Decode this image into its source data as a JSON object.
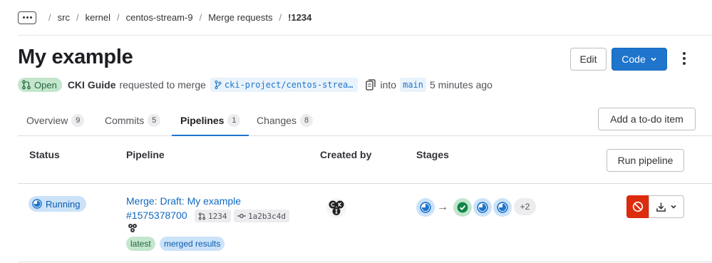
{
  "breadcrumb": {
    "items": [
      "src",
      "kernel",
      "centos-stream-9",
      "Merge requests",
      "!1234"
    ]
  },
  "mr": {
    "title": "My example",
    "edit_label": "Edit",
    "code_label": "Code",
    "status": "Open",
    "author": "CKI Guide",
    "requested_text": "requested to merge",
    "source_branch": "cki-project/centos-strea…",
    "into_text": "into",
    "target_branch": "main",
    "time_ago": "5 minutes ago"
  },
  "tabs": [
    {
      "label": "Overview",
      "count": "9"
    },
    {
      "label": "Commits",
      "count": "5"
    },
    {
      "label": "Pipelines",
      "count": "1"
    },
    {
      "label": "Changes",
      "count": "8"
    }
  ],
  "todo_label": "Add a to-do item",
  "table": {
    "headers": {
      "status": "Status",
      "pipeline": "Pipeline",
      "created_by": "Created by",
      "stages": "Stages"
    },
    "run_pipeline_label": "Run pipeline"
  },
  "pipeline": {
    "status": "Running",
    "title": "Merge: Draft: My example",
    "id": "#1575378700",
    "mr_ref": "1234",
    "commit": "1a2b3c4d",
    "labels": [
      "latest",
      "merged results"
    ],
    "stages": [
      "running",
      "success",
      "running",
      "running"
    ],
    "more_stages": "+2"
  },
  "colors": {
    "link": "#1068bf",
    "primary": "#1f75cb",
    "danger": "#dd2b0e",
    "running_bg": "#cbe2f9",
    "success_bg": "#c3e6cd"
  },
  "icons": {
    "merge_request": "merge-request-icon",
    "branch": "branch-icon",
    "copy": "copy-icon",
    "running": "status-running-icon",
    "success": "status-success-icon",
    "cancel": "cancel-icon",
    "download": "download-icon",
    "chevron": "chevron-down-icon",
    "kebab": "more-actions-icon",
    "commit": "commit-icon"
  }
}
